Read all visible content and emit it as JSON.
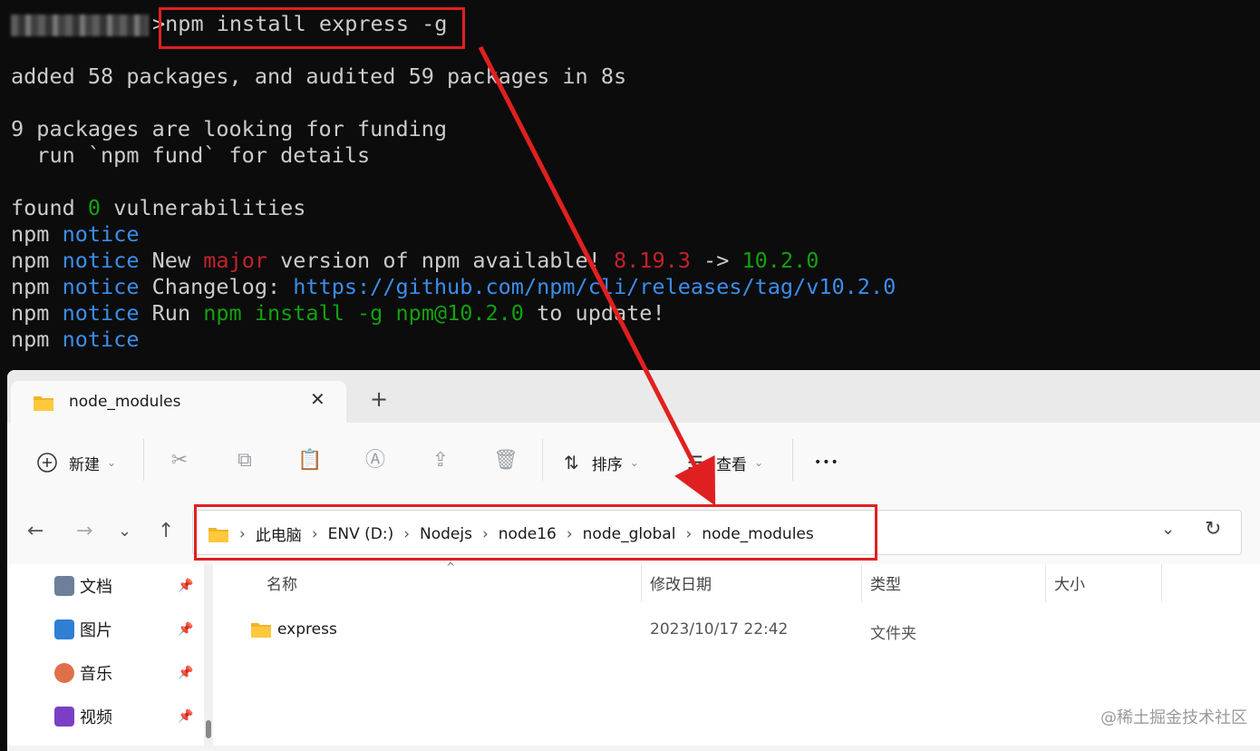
{
  "terminal": {
    "prompt_symbol": ">",
    "command": "npm install express -g",
    "line_added": "added 58 packages, and audited 59 packages in 8s",
    "line_funding": "9 packages are looking for funding",
    "line_fund_run": "  run `npm fund` for details",
    "found_prefix": "found ",
    "found_count": "0",
    "found_suffix": " vulnerabilities",
    "npm": "npm",
    "notice": "notice",
    "new_text": " New ",
    "major": "major",
    "version_text": " version of npm available! ",
    "old_version": "8.19.3",
    "arrow_text": " -> ",
    "new_version": "10.2.0",
    "changelog_label": " Changelog: ",
    "changelog_url": "https://github.com/npm/cli/releases/tag/v10.2.0",
    "run_text": " Run ",
    "update_cmd": "npm install -g npm@10.2.0",
    "to_update": " to update!"
  },
  "explorer": {
    "tab_title": "node_modules",
    "toolbar": {
      "new_label": "新建",
      "sort_label": "排序",
      "view_label": "查看",
      "more_label": "•••"
    },
    "breadcrumbs": [
      "此电脑",
      "ENV (D:)",
      "Nodejs",
      "node16",
      "node_global",
      "node_modules"
    ],
    "sidebar": [
      {
        "label": "文档",
        "color": "#6d7f99"
      },
      {
        "label": "图片",
        "color": "#2f7fd3"
      },
      {
        "label": "音乐",
        "color": "#e0704a"
      },
      {
        "label": "视频",
        "color": "#7b3fc6"
      }
    ],
    "columns": {
      "name": "名称",
      "date": "修改日期",
      "type": "类型",
      "size": "大小"
    },
    "files": [
      {
        "name": "express",
        "date": "2023/10/17 22:42",
        "type": "文件夹",
        "size": ""
      }
    ]
  },
  "watermark": "@稀土掘金技术社区",
  "accent_colors": {
    "annotation_red": "#e02020",
    "notice_blue": "#3b8eea",
    "major_red": "#c5212d",
    "ok_green": "#13a10e"
  }
}
